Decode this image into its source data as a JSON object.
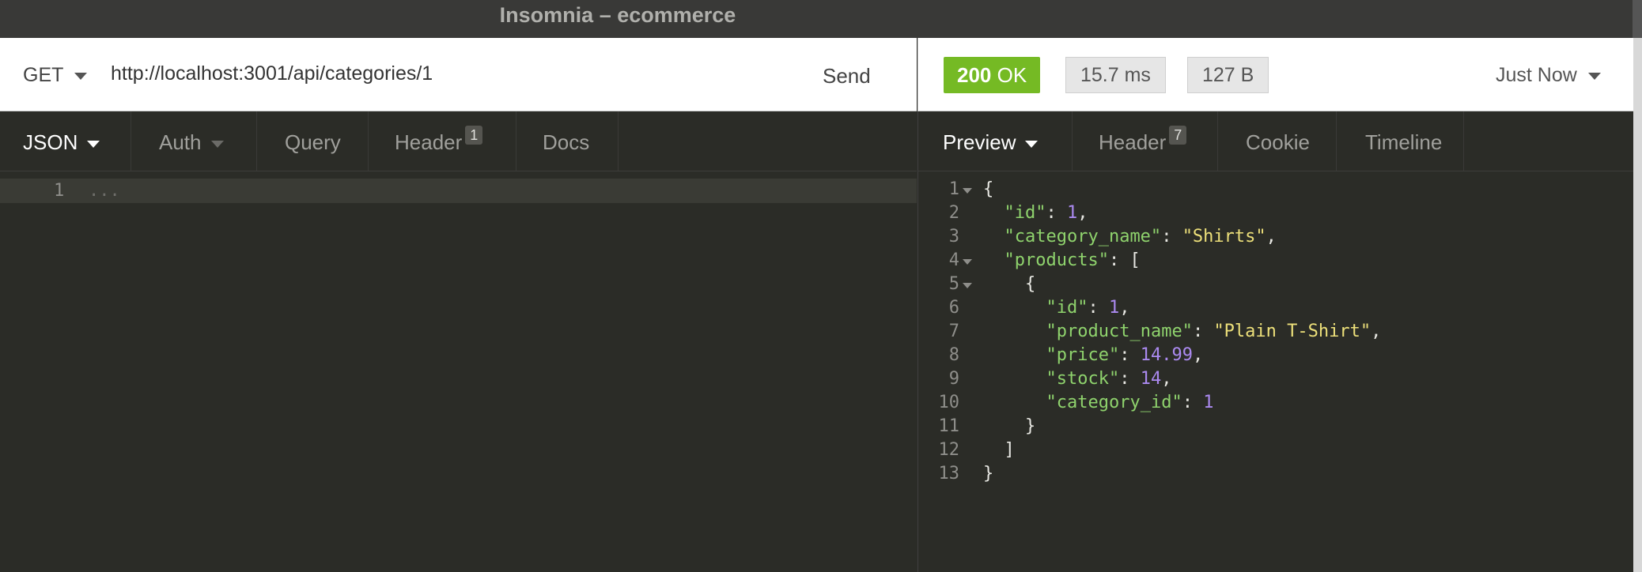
{
  "window": {
    "title": "Insomnia – ecommerce"
  },
  "request": {
    "method": "GET",
    "url": "http://localhost:3001/api/categories/1",
    "send_label": "Send"
  },
  "response_meta": {
    "status_code": "200",
    "status_text": "OK",
    "time": "15.7 ms",
    "size": "127 B",
    "when": "Just Now",
    "colors": {
      "ok": "#75ba24"
    }
  },
  "request_tabs": [
    {
      "label": "JSON"
    },
    {
      "label": "Auth"
    },
    {
      "label": "Query"
    },
    {
      "label": "Header",
      "badge": "1"
    },
    {
      "label": "Docs"
    }
  ],
  "response_tabs": [
    {
      "label": "Preview"
    },
    {
      "label": "Header",
      "badge": "7"
    },
    {
      "label": "Cookie"
    },
    {
      "label": "Timeline"
    }
  ],
  "request_body": {
    "line_number": "1",
    "placeholder": "..."
  },
  "response_body": {
    "lines": [
      {
        "n": "1",
        "fold": true,
        "indent": 0,
        "parts": [
          [
            "p",
            "{"
          ]
        ]
      },
      {
        "n": "2",
        "fold": false,
        "indent": 1,
        "parts": [
          [
            "k",
            "\"id\""
          ],
          [
            "p",
            ": "
          ],
          [
            "n",
            "1"
          ],
          [
            "p",
            ","
          ]
        ]
      },
      {
        "n": "3",
        "fold": false,
        "indent": 1,
        "parts": [
          [
            "k",
            "\"category_name\""
          ],
          [
            "p",
            ": "
          ],
          [
            "s",
            "\"Shirts\""
          ],
          [
            "p",
            ","
          ]
        ]
      },
      {
        "n": "4",
        "fold": true,
        "indent": 1,
        "parts": [
          [
            "k",
            "\"products\""
          ],
          [
            "p",
            ": ["
          ]
        ]
      },
      {
        "n": "5",
        "fold": true,
        "indent": 2,
        "parts": [
          [
            "p",
            "{"
          ]
        ]
      },
      {
        "n": "6",
        "fold": false,
        "indent": 3,
        "parts": [
          [
            "k",
            "\"id\""
          ],
          [
            "p",
            ": "
          ],
          [
            "n",
            "1"
          ],
          [
            "p",
            ","
          ]
        ]
      },
      {
        "n": "7",
        "fold": false,
        "indent": 3,
        "parts": [
          [
            "k",
            "\"product_name\""
          ],
          [
            "p",
            ": "
          ],
          [
            "s",
            "\"Plain T-Shirt\""
          ],
          [
            "p",
            ","
          ]
        ]
      },
      {
        "n": "8",
        "fold": false,
        "indent": 3,
        "parts": [
          [
            "k",
            "\"price\""
          ],
          [
            "p",
            ": "
          ],
          [
            "n",
            "14.99"
          ],
          [
            "p",
            ","
          ]
        ]
      },
      {
        "n": "9",
        "fold": false,
        "indent": 3,
        "parts": [
          [
            "k",
            "\"stock\""
          ],
          [
            "p",
            ": "
          ],
          [
            "n",
            "14"
          ],
          [
            "p",
            ","
          ]
        ]
      },
      {
        "n": "10",
        "fold": false,
        "indent": 3,
        "parts": [
          [
            "k",
            "\"category_id\""
          ],
          [
            "p",
            ": "
          ],
          [
            "n",
            "1"
          ]
        ]
      },
      {
        "n": "11",
        "fold": false,
        "indent": 2,
        "parts": [
          [
            "p",
            "}"
          ]
        ]
      },
      {
        "n": "12",
        "fold": false,
        "indent": 1,
        "parts": [
          [
            "p",
            "]"
          ]
        ]
      },
      {
        "n": "13",
        "fold": false,
        "indent": 0,
        "parts": [
          [
            "p",
            "}"
          ]
        ]
      }
    ]
  }
}
